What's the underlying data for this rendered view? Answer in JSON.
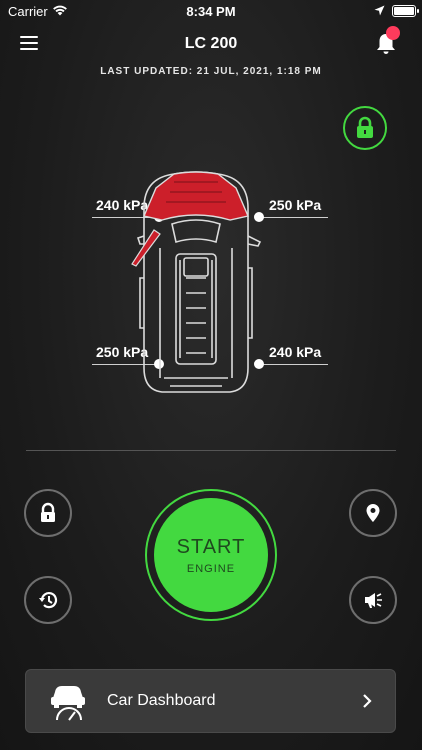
{
  "status_bar": {
    "carrier": "Carrier",
    "time": "8:34 PM"
  },
  "header": {
    "title": "LC 200",
    "last_updated": "LAST UPDATED: 21 JUL, 2021, 1:18 PM"
  },
  "tires": {
    "front_left": "240 kPa",
    "front_right": "250 kPa",
    "rear_left": "250 kPa",
    "rear_right": "240 kPa"
  },
  "car_state": {
    "locked": true,
    "hood_open": true,
    "driver_door_open": true
  },
  "start_button": {
    "line1": "START",
    "line2": "ENGINE"
  },
  "dashboard_button": {
    "label": "Car Dashboard"
  },
  "colors": {
    "accent_green": "#43d940",
    "alert_red": "#cc1f2a",
    "badge_red": "#ff3b5c"
  },
  "icons": {
    "lock_status": "lock-icon",
    "left_top": "lock-icon",
    "left_bottom": "history-icon",
    "right_top": "location-pin-icon",
    "right_bottom": "horn-icon",
    "dashboard": "car-dashboard-icon",
    "dashboard_chevron": "chevron-right-icon"
  }
}
